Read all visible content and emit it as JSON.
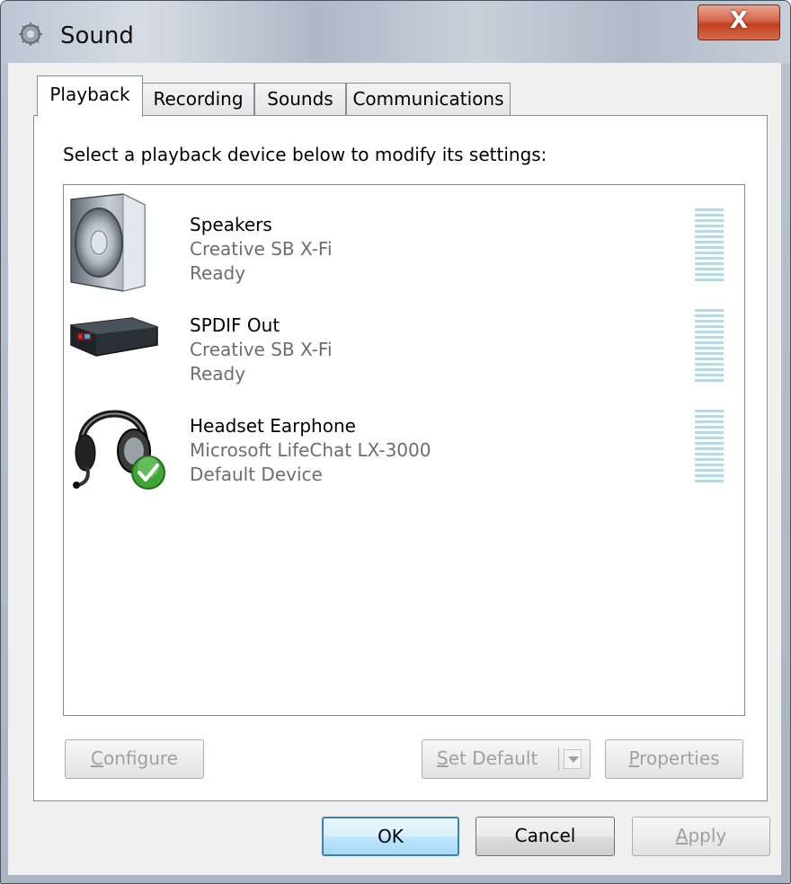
{
  "window": {
    "title": "Sound",
    "close_label": "X"
  },
  "tabs": [
    {
      "label": "Playback",
      "active": true
    },
    {
      "label": "Recording",
      "active": false
    },
    {
      "label": "Sounds",
      "active": false
    },
    {
      "label": "Communications",
      "active": false
    }
  ],
  "instruction": "Select a playback device below to modify its settings:",
  "devices": [
    {
      "name": "Speakers",
      "driver": "Creative SB X-Fi",
      "status": "Ready",
      "icon": "speaker-icon",
      "default": false
    },
    {
      "name": "SPDIF Out",
      "driver": "Creative SB X-Fi",
      "status": "Ready",
      "icon": "digital-output-icon",
      "default": false
    },
    {
      "name": "Headset Earphone",
      "driver": "Microsoft LifeChat LX-3000",
      "status": "Default Device",
      "icon": "headset-icon",
      "default": true
    }
  ],
  "buttons": {
    "configure": {
      "prefix": "",
      "accel": "C",
      "rest": "onfigure",
      "enabled": false
    },
    "set_default": {
      "prefix": "",
      "accel": "S",
      "rest": "et Default",
      "enabled": false
    },
    "properties": {
      "prefix": "",
      "accel": "P",
      "rest": "roperties",
      "enabled": false
    },
    "ok": {
      "label": "OK",
      "enabled": true
    },
    "cancel": {
      "label": "Cancel",
      "enabled": true
    },
    "apply": {
      "prefix": "",
      "accel": "A",
      "rest": "pply",
      "enabled": false
    }
  },
  "colors": {
    "meter": "#b9d9e2",
    "disabled_text": "#a0a0a0",
    "default_check": "#3fa535"
  }
}
